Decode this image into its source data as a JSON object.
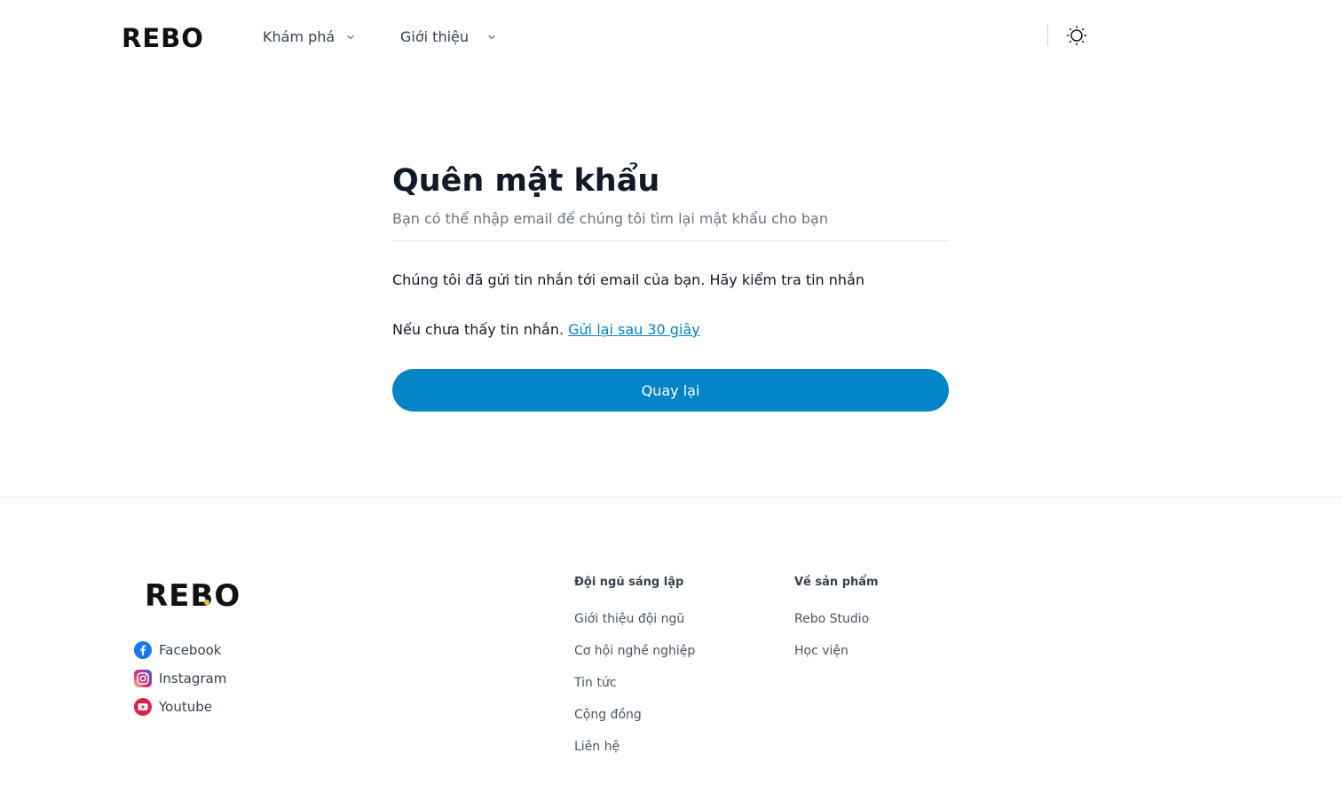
{
  "header": {
    "logo": "REBO",
    "nav": [
      {
        "label": "Khám phá"
      },
      {
        "label": "Giới thiệu"
      }
    ],
    "theme_icon": "sun-icon"
  },
  "form": {
    "title": "Quên mật khẩu",
    "subtitle": "Bạn có thể nhập email để chúng tôi tìm lại mật khẩu cho bạn",
    "message": "Chúng tôi đã gửi tin nhắn tới email của bạn. Hãy kiểm tra tin nhắn",
    "resend_prefix": "Nếu chưa thấy tin nhắn.",
    "resend_link": "Gửi lại sau 30 giây",
    "back_button": "Quay lại"
  },
  "footer": {
    "logo": "REBO",
    "social": [
      {
        "label": "Facebook",
        "icon": "facebook-icon"
      },
      {
        "label": "Instagram",
        "icon": "instagram-icon"
      },
      {
        "label": "Youtube",
        "icon": "youtube-icon"
      }
    ],
    "columns": [
      {
        "title": "Đội ngũ sáng lập",
        "links": [
          "Giới thiệu đội ngũ",
          "Cơ hội nghề nghiệp",
          "Tin tức",
          "Cộng đồng",
          "Liên hệ"
        ]
      },
      {
        "title": "Về sản phẩm",
        "links": [
          "Rebo Studio",
          "Học viện"
        ]
      }
    ]
  },
  "colors": {
    "primary": "#0284c7",
    "text": "#111827",
    "muted": "#6b7280",
    "accent_dot": "#fbbf24"
  }
}
